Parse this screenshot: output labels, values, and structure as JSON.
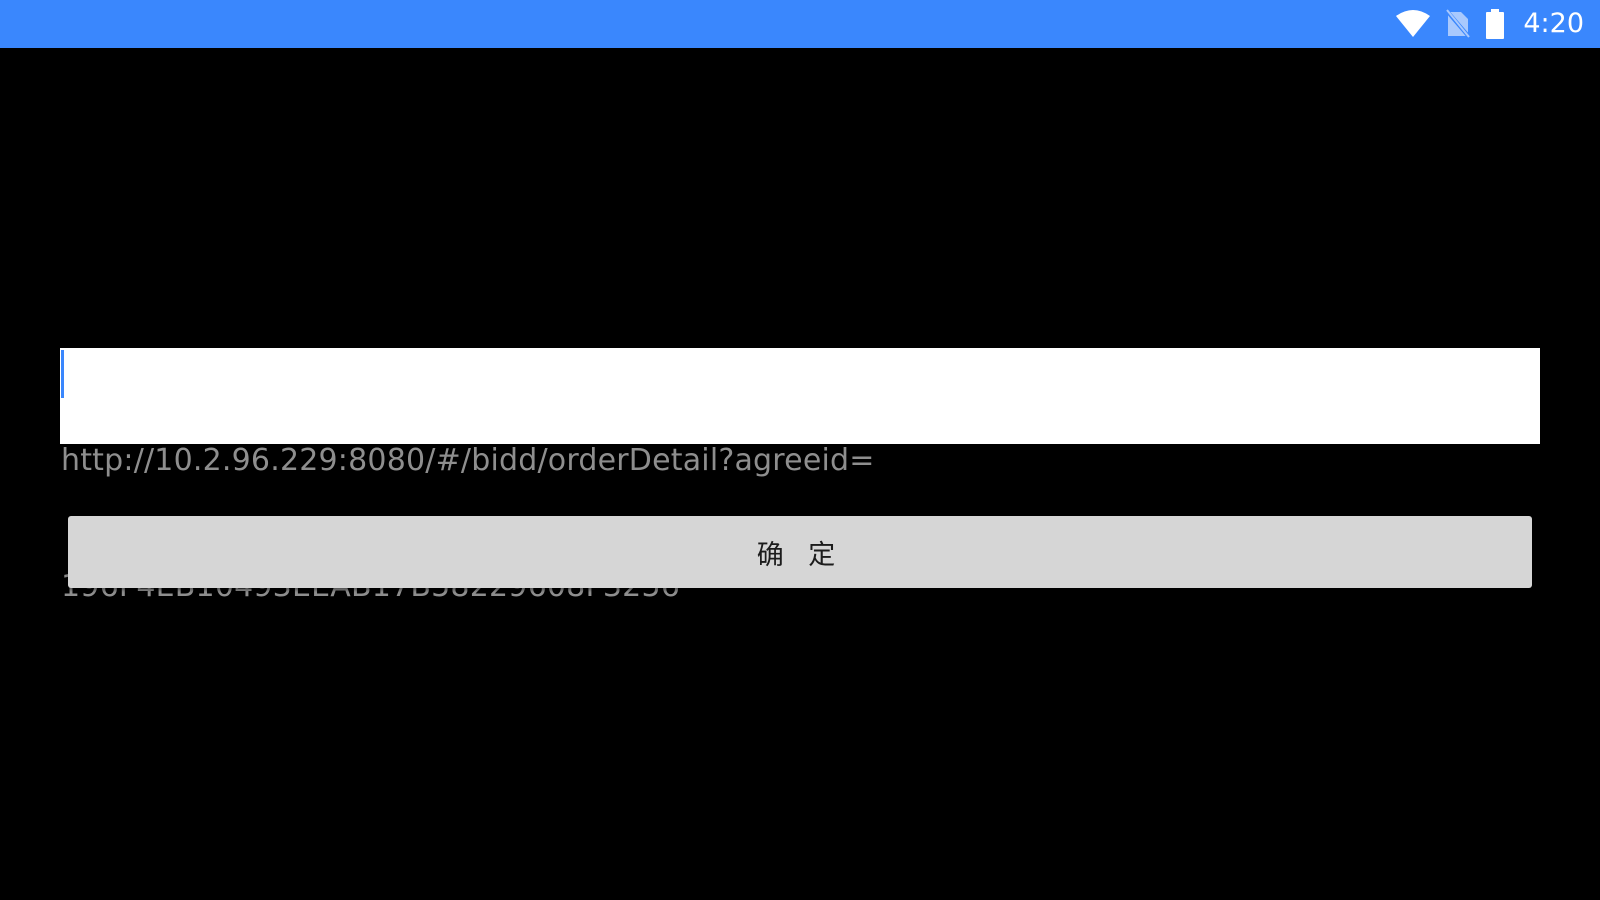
{
  "status_bar": {
    "time": "4:20",
    "background_color": "#3a87fd",
    "icons": [
      "wifi-icon",
      "no-sim-icon",
      "battery-icon"
    ]
  },
  "url_input": {
    "value_line1": "http://10.2.96.229:8080/#/bidd/orderDetail?agreeid=",
    "value_line2": "196F4EB10493EEAB17B58229608F3256",
    "text_color": "#8e8e8e"
  },
  "confirm_button": {
    "label": "确 定",
    "background_color": "#d6d6d6"
  }
}
